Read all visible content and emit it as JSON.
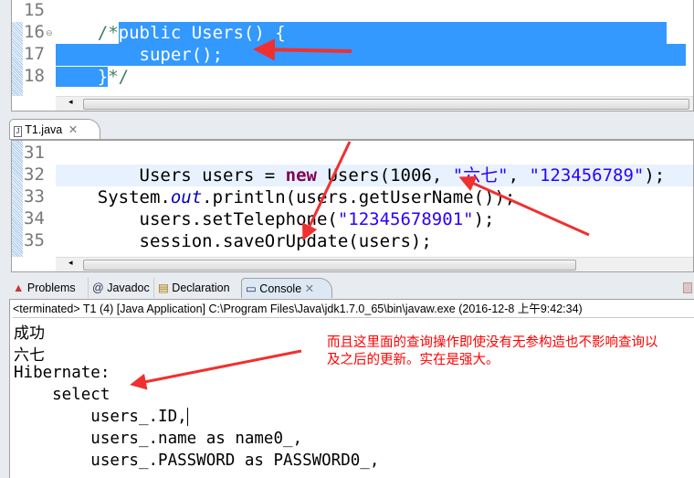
{
  "editor_top": {
    "lines": [
      {
        "num": "15",
        "text": ""
      },
      {
        "num": "16",
        "pre": "    /*",
        "sel": "public Users() {"
      },
      {
        "num": "17",
        "sel": "        super();"
      },
      {
        "num": "18",
        "sel": "    }",
        "post": "*/"
      }
    ]
  },
  "editor_tab": {
    "label": "T1.java"
  },
  "editor_main": {
    "lines": {
      "l31": {
        "num": "31"
      },
      "l32": {
        "num": "32",
        "a": "        Users users = ",
        "kw": "new",
        "b": " Users(1006, ",
        "s1": "\"六七\"",
        "c": ", ",
        "s2": "\"123456789\"",
        "d": ");"
      },
      "l33": {
        "num": "33",
        "a": "    System.",
        "it": "out",
        "b": ".println(users.getUserName());"
      },
      "l34": {
        "num": "34",
        "a": "        users.setTelephone(",
        "s": "\"12345678901\"",
        "b": ");"
      },
      "l35": {
        "num": "35",
        "a": "        session.saveOrUpdate(users);"
      }
    }
  },
  "bottom_tabs": [
    "Problems",
    "Javadoc",
    "Declaration",
    "Console"
  ],
  "console": {
    "status": "<terminated> T1 (4) [Java Application] C:\\Program Files\\Java\\jdk1.7.0_65\\bin\\javaw.exe (2016-12-8 上午9:42:34)",
    "output": [
      "成功",
      "六七"
    ],
    "sql": [
      "Hibernate:",
      "    select",
      "        users_.ID,",
      "        users_.name as name0_,",
      "        users_.PASSWORD as PASSWORD0_,"
    ]
  },
  "annotation": {
    "line1": "而且这里面的查询操作即使没有无参构造也不影响查询以",
    "line2": "及之后的更新。实在是强大。",
    "color": "#ff0000"
  }
}
